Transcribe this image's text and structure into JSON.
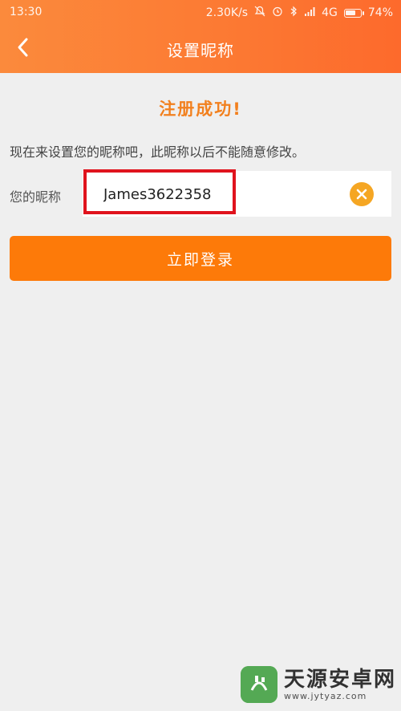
{
  "status_bar": {
    "time": "13:30",
    "network_speed": "2.30K/s",
    "network_type": "4G",
    "battery": "74%",
    "battery_level": 0.74,
    "icons": [
      "mute-bell-icon",
      "alarm-icon",
      "bluetooth-icon",
      "signal-icon"
    ]
  },
  "header": {
    "title": "设置昵称",
    "back_icon": "chevron-left-icon"
  },
  "main": {
    "success_title": "注册成功!",
    "hint": "现在来设置您的昵称吧，此昵称以后不能随意修改。",
    "field_label": "您的昵称",
    "nickname_value": "James3622358",
    "clear_icon": "clear-x-icon",
    "login_button": "立即登录"
  },
  "watermark": {
    "name": "天源安卓网",
    "url": "www.jytyaz.com"
  },
  "colors": {
    "header_gradient_start": "#fb8a3c",
    "header_gradient_end": "#fd6a2c",
    "accent_orange": "#fd7a09",
    "title_orange": "#f2801e",
    "highlight_red": "#e0131d",
    "background": "#efefef"
  }
}
